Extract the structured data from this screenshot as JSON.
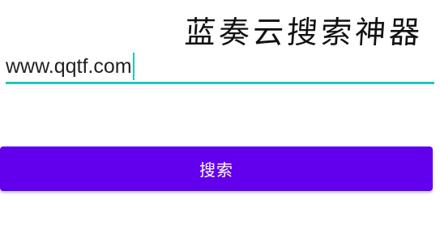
{
  "app": {
    "title": "蓝奏云搜索神器"
  },
  "search": {
    "value": "www.qqtf.com",
    "accent_color": "#1fc8be"
  },
  "button": {
    "label": "搜索",
    "background_color": "#6200ee",
    "text_color": "#ffffff"
  }
}
